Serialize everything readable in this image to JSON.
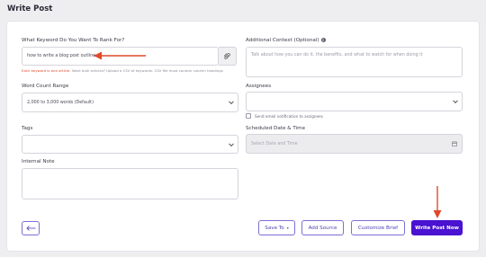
{
  "page": {
    "title": "Write Post"
  },
  "keyword": {
    "label": "What Keyword Do You Want To Rank For?",
    "value": "how to write a blog post outline",
    "error": "Each keyword is one article.",
    "hint": "Want bulk articles? Upload a CSV of keywords. CSV file must contain column headings"
  },
  "context": {
    "label": "Additional Context (Optional)",
    "placeholder": "Talk about how you can do it, the benefits, and what to watch for when doing it"
  },
  "word_count": {
    "label": "Word Count Range",
    "selected": "2,000 to 3,000 words (Default)"
  },
  "assignees": {
    "label": "Assignees",
    "selected": "",
    "notify_label": "Send email notification to assignees"
  },
  "tags": {
    "label": "Tags",
    "selected": ""
  },
  "schedule": {
    "label": "Scheduled Date & Time",
    "placeholder": "Select Date and Time"
  },
  "note": {
    "label": "Internal Note",
    "value": ""
  },
  "actions": {
    "save_to": "Save To",
    "add_source": "Add Source",
    "customize_brief": "Customize Brief",
    "write_post": "Write Post Now"
  },
  "colors": {
    "primary": "#4a12d1",
    "accent_border": "#7c6fd6",
    "annotation_arrow": "#e0492a"
  },
  "icons": [
    "paperclip-icon",
    "info-icon",
    "chevron-down-icon",
    "calendar-icon",
    "back-arrow-icon",
    "caret-down-icon"
  ]
}
